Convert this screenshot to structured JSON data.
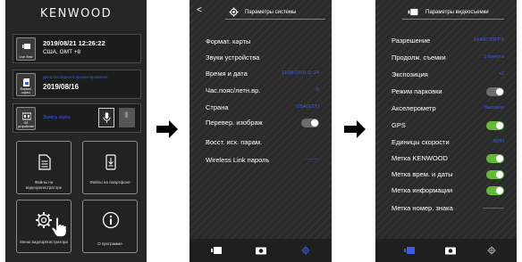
{
  "screen1": {
    "logo": "KENWOOD",
    "live_view": {
      "caption": "Live View",
      "datetime": "2019/08/21  12:26:22",
      "timezone": "США, GMT +8"
    },
    "format": {
      "caption": "Формат. карты",
      "label": "Дата последнего форматирования",
      "date": "2019/08/16"
    },
    "audio": {
      "caption": "Об устройстве",
      "label": "Запись звука"
    },
    "tiles": [
      {
        "label": "Файлы на видеорегистраторе",
        "icon": "file-document-icon"
      },
      {
        "label": "Файлы на смартфоне",
        "icon": "phone-download-icon"
      },
      {
        "label": "Меню видеорегистратора",
        "icon": "gear-icon"
      },
      {
        "label": "О программе",
        "icon": "info-icon"
      }
    ]
  },
  "screen2": {
    "back": "<",
    "title": "Параметры системы",
    "items": [
      {
        "label": "Формат. карты"
      },
      {
        "label": "Звуки устройства"
      },
      {
        "label": "Время и дата",
        "value": "11/08/2018,11:24"
      },
      {
        "label": "Час.пояс/летн.вр.",
        "value": "-5"
      },
      {
        "label": "Страна",
        "value": "USA(EST)"
      },
      {
        "label": "Перевер. изображ",
        "toggle": "off"
      },
      {
        "label": "Восст. исх. парам."
      },
      {
        "label": "Wireless Link пароль",
        "value": "--------"
      }
    ]
  },
  "screen3": {
    "title": "Параметры видеосъемки",
    "items": [
      {
        "label": "Разрешение",
        "value": "1440P 30FPS"
      },
      {
        "label": "Продолж. съемки",
        "value": "1 минута"
      },
      {
        "label": "Экспозиция",
        "value": "+2"
      },
      {
        "label": "Режим парковки",
        "toggle": "off"
      },
      {
        "label": "Акселерометр",
        "value": "Высокое"
      },
      {
        "label": "GPS",
        "toggle": "on"
      },
      {
        "label": "Единицы скорости",
        "value": "MPH"
      },
      {
        "label": "Метка KENWOOD",
        "toggle": "on"
      },
      {
        "label": "Метка врем. и даты",
        "toggle": "on"
      },
      {
        "label": "Метка информации",
        "toggle": "on"
      },
      {
        "label": "Метка номер. знака"
      }
    ]
  },
  "colors": {
    "accent_blue": "#3c5ce6",
    "toggle_on": "#66b83a",
    "toggle_off": "#6d6d6d"
  }
}
